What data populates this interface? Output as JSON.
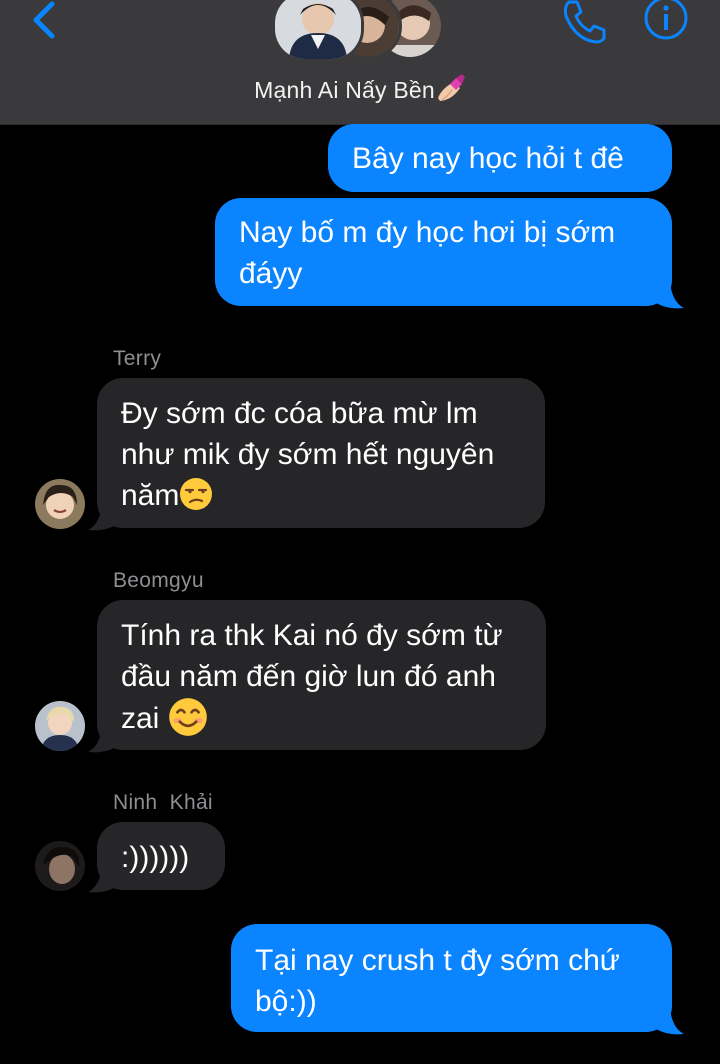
{
  "header": {
    "group_name": "Mạnh Ai Nấy Bền",
    "name_emoji": "nail-polish-emoji",
    "back_icon": "chevron-left-icon",
    "call_icon": "phone-icon",
    "info_icon": "info-icon"
  },
  "colors": {
    "accent": "#0a84ff",
    "outgoing_bubble": "#0a84ff",
    "incoming_bubble": "#262628",
    "header_bg": "#3a3a3c",
    "sender_label": "#8e8e93"
  },
  "messages": [
    {
      "direction": "outgoing",
      "text": "Bây nay học hỏi t đê"
    },
    {
      "direction": "outgoing",
      "text": "Nay bố m đy học hơi bị sớm đáyy"
    },
    {
      "direction": "incoming",
      "sender": "Terry",
      "text": "Đy sớm đc cóa bữa mừ lm như mik đy sớm hết nguyên năm",
      "emoji": "unamused-face"
    },
    {
      "direction": "incoming",
      "sender": "Beomgyu",
      "text": "Tính ra thk Kai nó đy sớm từ đầu năm đến giờ lun đó anh zai",
      "emoji": "smiling-face"
    },
    {
      "direction": "incoming",
      "sender": "Ninh  Khải",
      "text": ":))))))"
    },
    {
      "direction": "outgoing",
      "text": "Tại nay crush t đy sớm chứ bộ:))"
    }
  ],
  "lines": {
    "m1": "Bây nay học hỏi t đê",
    "m2_l1": "Nay bố m đy học hơi bị sớm",
    "m2_l2": "đáyy",
    "m3_l1": "Đy sớm đc cóa bữa mừ lm",
    "m3_l2": "như mik đy sớm hết nguyên",
    "m3_l3": "năm",
    "m4_l1": "Tính ra thk Kai nó đy sớm từ",
    "m4_l2": "đầu năm đến giờ lun đó anh",
    "m4_l3": "zai ",
    "m5": ":))))))",
    "m6_l1": "Tại nay crush t đy sớm chứ",
    "m6_l2": "bộ:))"
  }
}
